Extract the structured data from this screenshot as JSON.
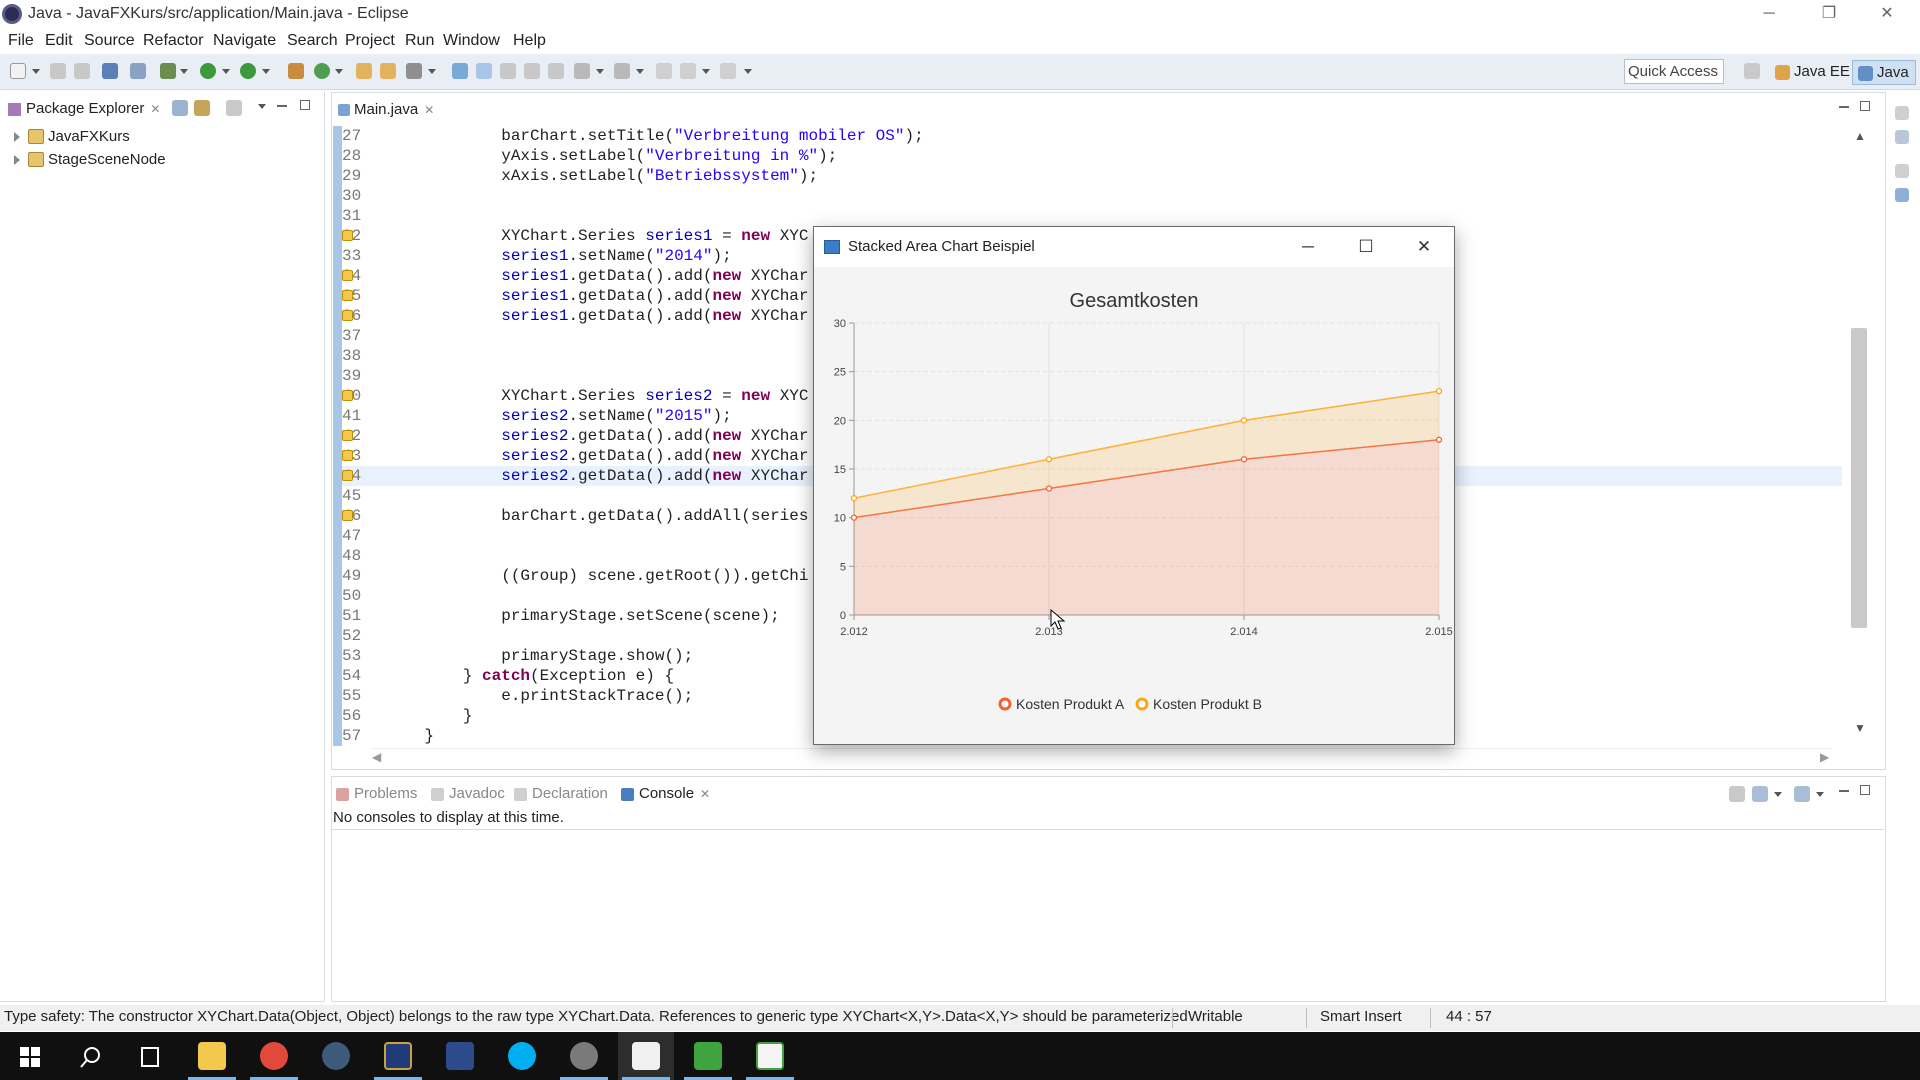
{
  "window": {
    "title": "Java - JavaFXKurs/src/application/Main.java - Eclipse",
    "minimize": "─",
    "restore": "❐",
    "close": "✕"
  },
  "menu": [
    "File",
    "Edit",
    "Source",
    "Refactor",
    "Navigate",
    "Search",
    "Project",
    "Run",
    "Window",
    "Help"
  ],
  "toolbar": {
    "quick_access": "Quick Access",
    "perspectives": [
      "Java EE",
      "Java"
    ]
  },
  "package_explorer": {
    "title": "Package Explorer",
    "tab_close": "✕",
    "projects": [
      "JavaFXKurs",
      "StageSceneNode"
    ]
  },
  "editor": {
    "tab": "Main.java",
    "tab_close": "✕",
    "current_line": 44,
    "lines": [
      {
        "n": "27",
        "code": "            barChart.setTitle(\"Verbreitung mobiler OS\");",
        "warn": false
      },
      {
        "n": "28",
        "code": "            yAxis.setLabel(\"Verbreitung in %\");",
        "warn": false
      },
      {
        "n": "29",
        "code": "            xAxis.setLabel(\"Betriebssystem\");",
        "warn": false
      },
      {
        "n": "30",
        "code": "",
        "warn": false
      },
      {
        "n": "31",
        "code": "",
        "warn": false
      },
      {
        "n": "32",
        "code": "            XYChart.Series series1 = new XYC",
        "warn": true
      },
      {
        "n": "33",
        "code": "            series1.setName(\"2014\");",
        "warn": false
      },
      {
        "n": "34",
        "code": "            series1.getData().add(new XYChar",
        "warn": true
      },
      {
        "n": "35",
        "code": "            series1.getData().add(new XYChar",
        "warn": true
      },
      {
        "n": "36",
        "code": "            series1.getData().add(new XYChar",
        "warn": true
      },
      {
        "n": "37",
        "code": "",
        "warn": false
      },
      {
        "n": "38",
        "code": "",
        "warn": false
      },
      {
        "n": "39",
        "code": "",
        "warn": false
      },
      {
        "n": "40",
        "code": "            XYChart.Series series2 = new XYC",
        "warn": true
      },
      {
        "n": "41",
        "code": "            series2.setName(\"2015\");",
        "warn": false
      },
      {
        "n": "42",
        "code": "            series2.getData().add(new XYChar",
        "warn": true
      },
      {
        "n": "43",
        "code": "            series2.getData().add(new XYChar",
        "warn": true
      },
      {
        "n": "44",
        "code": "            series2.getData().add(new XYChar",
        "warn": true
      },
      {
        "n": "45",
        "code": "",
        "warn": false
      },
      {
        "n": "46",
        "code": "            barChart.getData().addAll(series",
        "warn": true
      },
      {
        "n": "47",
        "code": "",
        "warn": false
      },
      {
        "n": "48",
        "code": "",
        "warn": false
      },
      {
        "n": "49",
        "code": "            ((Group) scene.getRoot()).getChi",
        "warn": false
      },
      {
        "n": "50",
        "code": "",
        "warn": false
      },
      {
        "n": "51",
        "code": "            primaryStage.setScene(scene);",
        "warn": false
      },
      {
        "n": "52",
        "code": "",
        "warn": false
      },
      {
        "n": "53",
        "code": "            primaryStage.show();",
        "warn": false
      },
      {
        "n": "54",
        "code": "        } catch(Exception e) {",
        "warn": false
      },
      {
        "n": "55",
        "code": "            e.printStackTrace();",
        "warn": false
      },
      {
        "n": "56",
        "code": "        }",
        "warn": false
      },
      {
        "n": "57",
        "code": "    }",
        "warn": false
      }
    ]
  },
  "chart_window": {
    "title": "Stacked Area Chart Beispiel",
    "minimize": "─",
    "maximize": "☐",
    "close": "✕"
  },
  "chart_data": {
    "type": "area",
    "stacked": true,
    "title": "Gesamtkosten",
    "x": [
      "2.012",
      "2.013",
      "2.014",
      "2.015"
    ],
    "ylim": [
      0,
      30
    ],
    "y_ticks": [
      0,
      5,
      10,
      15,
      20,
      25,
      30
    ],
    "series": [
      {
        "name": "Kosten Produkt A",
        "values": [
          10,
          13,
          16,
          18
        ],
        "color": "#f3622d"
      },
      {
        "name": "Kosten Produkt B",
        "values": [
          2,
          3,
          4,
          5
        ],
        "color": "#fba71b"
      }
    ],
    "grid": true,
    "legend": "bottom"
  },
  "console": {
    "tabs": [
      "Problems",
      "Javadoc",
      "Declaration",
      "Console"
    ],
    "active": "Console",
    "tab_close": "✕",
    "message": "No consoles to display at this time."
  },
  "status": {
    "message": "Type safety: The constructor XYChart.Data(Object, Object) belongs to the raw type XYChart.Data. References to generic type XYChart<X,Y>.Data<X,Y> should be parameterized",
    "mode": "Writable",
    "insert": "Smart Insert",
    "position": "44 : 57"
  },
  "taskbar": {
    "items": [
      "start",
      "search",
      "task-view",
      "file-explorer",
      "chrome",
      "steam",
      "launcher",
      "visual-studio",
      "skype",
      "settings",
      "java",
      "camtasia-green",
      "camtasia-white"
    ],
    "active": "java"
  }
}
